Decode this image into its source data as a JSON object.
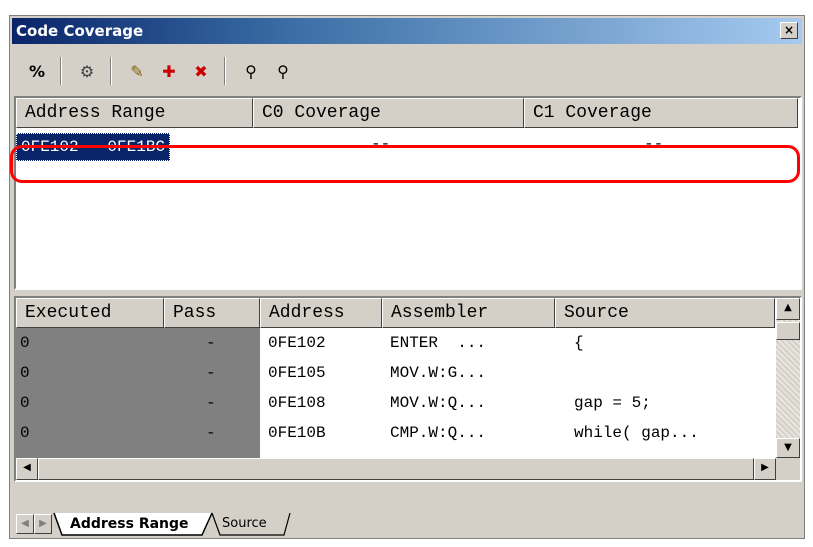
{
  "window": {
    "title": "Code Coverage",
    "close_glyph": "×"
  },
  "toolbar": [
    {
      "name": "percent-icon",
      "glyph": "%"
    },
    {
      "name": "coverage-settings-icon",
      "glyph": "⚙"
    },
    {
      "name": "edit-range-icon",
      "glyph": "✎"
    },
    {
      "name": "add-range-icon",
      "glyph": "✚"
    },
    {
      "name": "delete-range-icon",
      "glyph": "✖"
    },
    {
      "name": "find-icon",
      "glyph": "⚲"
    },
    {
      "name": "find-next-icon",
      "glyph": "⚲"
    }
  ],
  "range_table": {
    "columns": [
      "Address Range",
      "C0 Coverage",
      "C1 Coverage"
    ],
    "rows": [
      {
        "range": "0FE102 - 0FE1BC",
        "c0": "--",
        "c1": "--"
      }
    ]
  },
  "source_table": {
    "columns": [
      "Executed",
      "Pass",
      "Address",
      "Assembler",
      "Source"
    ],
    "rows": [
      {
        "executed": "0",
        "pass": "-",
        "address": "0FE102",
        "assembler": "ENTER  ...",
        "source": "{"
      },
      {
        "executed": "0",
        "pass": "-",
        "address": "0FE105",
        "assembler": "MOV.W:G...",
        "source": ""
      },
      {
        "executed": "0",
        "pass": "-",
        "address": "0FE108",
        "assembler": "MOV.W:Q...",
        "source": "gap = 5;"
      },
      {
        "executed": "0",
        "pass": "-",
        "address": "0FE10B",
        "assembler": "CMP.W:Q...",
        "source": "while( gap..."
      }
    ]
  },
  "tabs": [
    {
      "label": "Address Range",
      "active": true
    },
    {
      "label": "Source",
      "active": false
    }
  ],
  "colors": {
    "highlight": "#ff0000",
    "selection": "#0a246a",
    "gray_column": "#808080"
  }
}
